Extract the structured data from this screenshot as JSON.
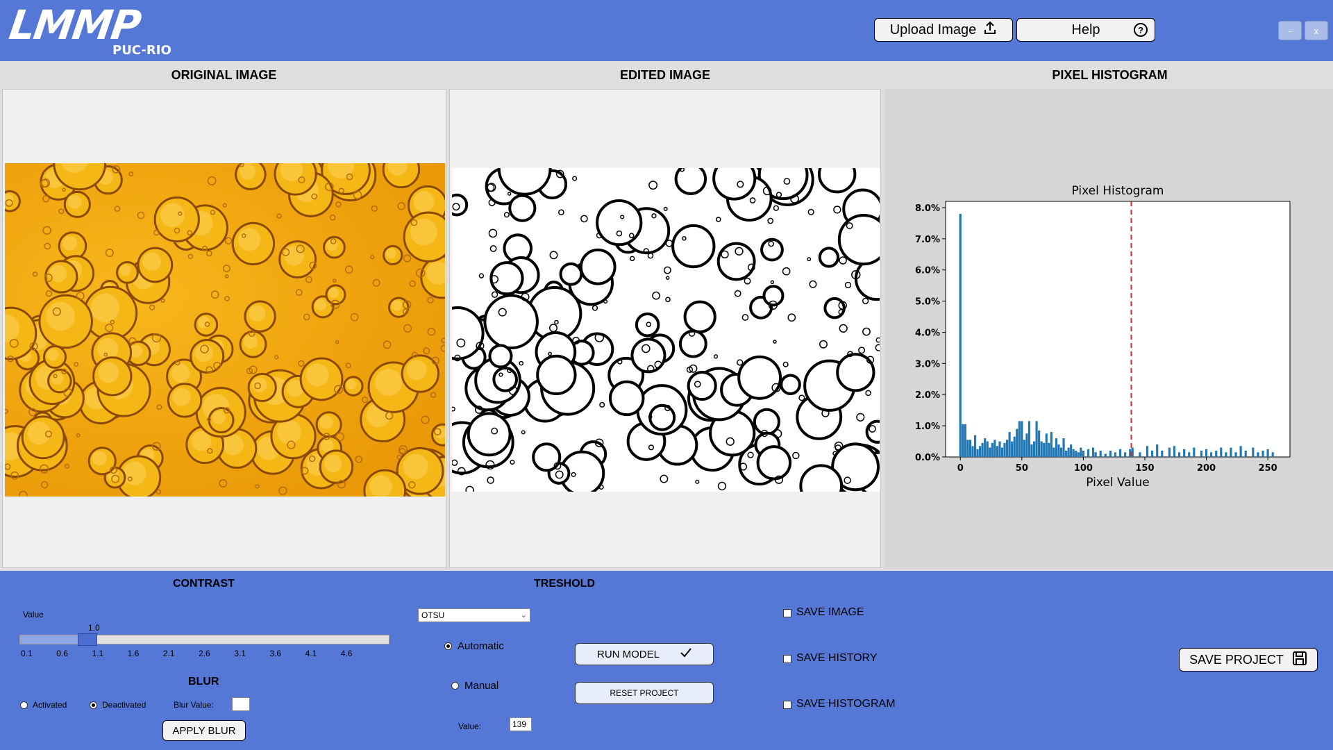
{
  "app": {
    "logo": {
      "main": "LMMP",
      "sub": "PUC-RIO"
    },
    "upload_label": "Upload Image",
    "help_label": "Help",
    "minimize_label": "-",
    "close_label": "x"
  },
  "columns": {
    "original_title": "ORIGINAL IMAGE",
    "edited_title": "EDITED IMAGE",
    "histogram_title": "PIXEL HISTOGRAM"
  },
  "contrast": {
    "title": "CONTRAST",
    "value_label": "Value",
    "current_value": "1.0",
    "slider_level": 1.0,
    "ticks": [
      "0.1",
      "0.6",
      "1.1",
      "1.6",
      "2.1",
      "2.6",
      "3.1",
      "3.6",
      "4.1",
      "4.6"
    ]
  },
  "blur": {
    "title": "BLUR",
    "activated_label": "Activated",
    "deactivated_label": "Deactivated",
    "selected": "Deactivated",
    "value_label": "Blur Value:",
    "value": "",
    "apply_label": "APPLY BLUR"
  },
  "threshold": {
    "title": "TRESHOLD",
    "method": "OTSU",
    "automatic_label": "Automatic",
    "manual_label": "Manual",
    "selected_mode": "Automatic",
    "value_label": "Value:",
    "value": "139"
  },
  "actions": {
    "run_label": "RUN MODEL",
    "reset_label": "RESET PROJECT",
    "save_image_label": "SAVE IMAGE",
    "save_history_label": "SAVE HISTORY",
    "save_histogram_label": "SAVE HISTOGRAM",
    "save_project_label": "SAVE PROJECT"
  },
  "colors": {
    "accent": "#5577d6",
    "bar": "#1f77b4",
    "threshold_line": "#d62728"
  },
  "icons": {
    "upload": "upload-icon",
    "help": "help-circle-icon",
    "check": "check-icon",
    "save": "floppy-disk-icon",
    "chevron": "chevron-down-icon"
  },
  "chart_data": {
    "type": "bar",
    "title": "Pixel Histogram",
    "xlabel": "Pixel Value",
    "ylabel": "",
    "xlim": [
      -12,
      268
    ],
    "ylim": [
      0,
      8.2
    ],
    "xticks": [
      0,
      50,
      100,
      150,
      200,
      250
    ],
    "xtick_labels": [
      "0",
      "50",
      "100",
      "150",
      "200",
      "250"
    ],
    "yticks": [
      0,
      1,
      2,
      3,
      4,
      5,
      6,
      7,
      8
    ],
    "ytick_labels": [
      "0.0%",
      "1.0%",
      "2.0%",
      "3.0%",
      "4.0%",
      "5.0%",
      "6.0%",
      "7.0%",
      "8.0%"
    ],
    "threshold": 139,
    "threshold_style": "dashed",
    "grid": false,
    "bin_width": 2,
    "x": [
      0,
      2,
      4,
      6,
      8,
      10,
      12,
      14,
      16,
      18,
      20,
      22,
      24,
      26,
      28,
      30,
      32,
      34,
      36,
      38,
      40,
      42,
      44,
      46,
      48,
      50,
      52,
      54,
      56,
      58,
      60,
      62,
      64,
      66,
      68,
      70,
      72,
      74,
      76,
      78,
      80,
      82,
      84,
      86,
      88,
      90,
      92,
      94,
      96,
      98,
      100,
      104,
      108,
      110,
      114,
      118,
      122,
      126,
      130,
      134,
      138,
      140,
      146,
      152,
      156,
      160,
      164,
      170,
      174,
      178,
      182,
      186,
      190,
      196,
      200,
      204,
      208,
      212,
      216,
      220,
      224,
      228,
      232,
      238,
      242,
      246,
      250,
      254
    ],
    "values": [
      7.8,
      1.05,
      1.05,
      0.55,
      0.55,
      0.35,
      0.7,
      0.25,
      0.35,
      0.45,
      0.6,
      0.5,
      0.3,
      0.45,
      0.55,
      0.35,
      0.5,
      0.3,
      0.45,
      0.55,
      0.8,
      0.5,
      0.65,
      0.9,
      1.15,
      1.15,
      0.55,
      0.75,
      1.15,
      0.4,
      0.5,
      1.15,
      0.85,
      0.5,
      0.45,
      0.75,
      0.45,
      0.8,
      0.3,
      0.6,
      0.4,
      0.3,
      0.6,
      0.2,
      0.3,
      0.4,
      0.25,
      0.2,
      0.15,
      0.3,
      0.2,
      0.25,
      0.3,
      0.15,
      0.2,
      0.1,
      0.2,
      0.15,
      0.25,
      0.15,
      0.25,
      0.3,
      0.15,
      0.35,
      0.2,
      0.4,
      0.2,
      0.3,
      0.35,
      0.15,
      0.25,
      0.15,
      0.3,
      0.2,
      0.25,
      0.15,
      0.2,
      0.3,
      0.15,
      0.3,
      0.15,
      0.35,
      0.2,
      0.3,
      0.15,
      0.2,
      0.25,
      0.15
    ]
  }
}
